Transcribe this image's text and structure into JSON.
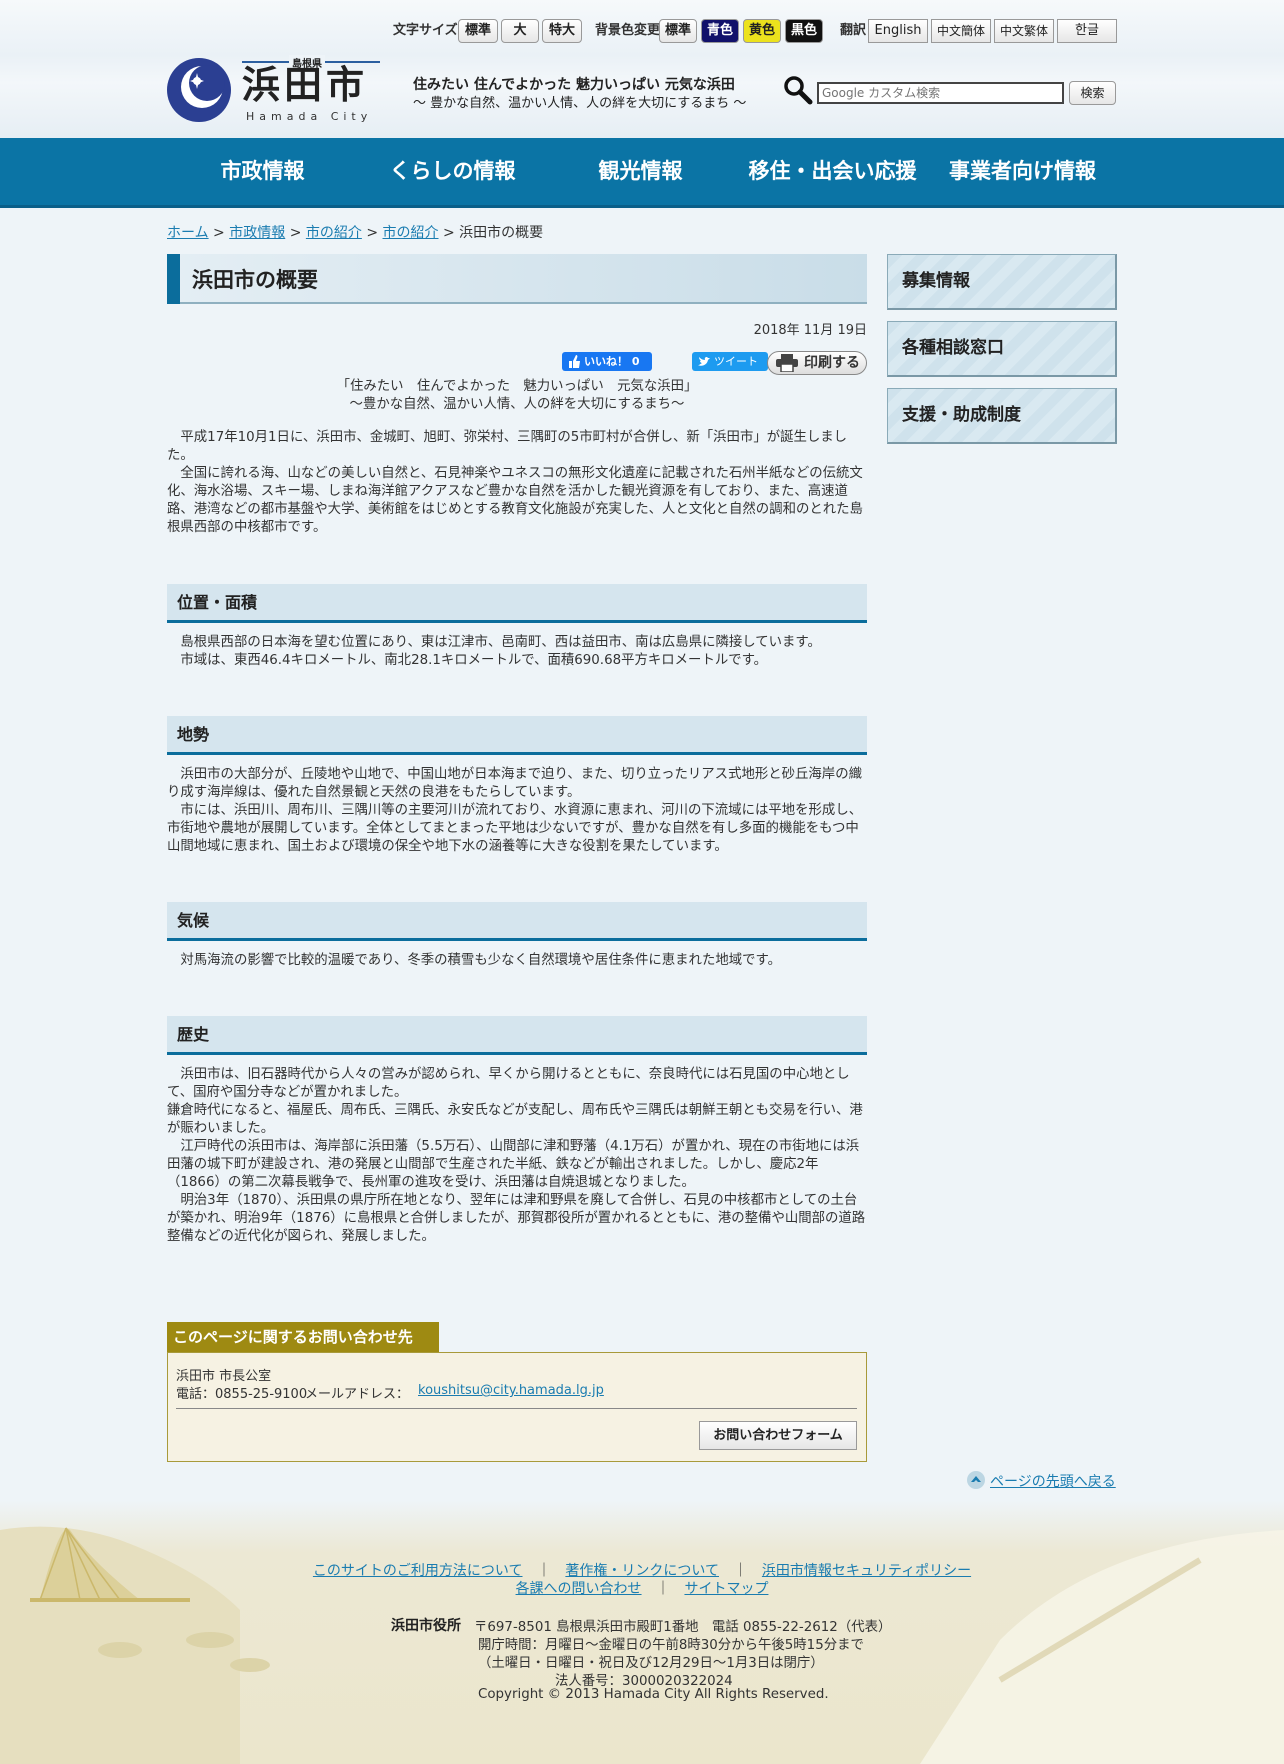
{
  "header": {
    "font_size_label": "文字サイズ",
    "font_std": "標準",
    "font_large": "大",
    "font_xlarge": "特大",
    "bg_label": "背景色変更",
    "bg_std": "標準",
    "bg_blue": "青色",
    "bg_yellow": "黄色",
    "bg_black": "黒色",
    "translate_label": "翻訳",
    "lang_en": "English",
    "lang_zh_cn": "中文簡体",
    "lang_zh_tw": "中文繁体",
    "lang_ko": "한글",
    "logo_pref": "島根県",
    "logo_city": "浜田市",
    "logo_roman": "Hamada City",
    "tagline1": "住みたい 住んでよかった 魅力いっぱい 元気な浜田",
    "tagline2": "〜 豊かな自然、温かい人情、人の絆を大切にするまち 〜",
    "search_placeholder": "Google カスタム検索",
    "search_button": "検索"
  },
  "nav": [
    "市政情報",
    "くらしの情報",
    "観光情報",
    "移住・出会い応援",
    "事業者向け情報"
  ],
  "breadcrumb": {
    "home": "ホーム",
    "l1": "市政情報",
    "l2": "市の紹介",
    "l3": "市の紹介",
    "sep": ">",
    "current": "浜田市の概要"
  },
  "page": {
    "title": "浜田市の概要",
    "date": "2018年 11月 19日",
    "like": "いいね！ 0",
    "tweet": "ツイート",
    "print": "印刷する",
    "motto1": "「住みたい　住んでよかった　魅力いっぱい　元気な浜田」",
    "motto2": "～豊かな自然、温かい人情、人の絆を大切にするまち～",
    "intro": "　平成17年10月1日に、浜田市、金城町、旭町、弥栄村、三隅町の5市町村が合併し、新「浜田市」が誕生しました。\n　全国に誇れる海、山などの美しい自然と、石見神楽やユネスコの無形文化遺産に記載された石州半紙などの伝統文化、海水浴場、スキー場、しまね海洋館アクアスなど豊かな自然を活かした観光資源を有しており、また、高速道路、港湾などの都市基盤や大学、美術館をはじめとする教育文化施設が充実した、人と文化と自然の調和のとれた島根県西部の中核都市です。",
    "sections": [
      {
        "heading": "位置・面積",
        "body": "　島根県西部の日本海を望む位置にあり、東は江津市、邑南町、西は益田市、南は広島県に隣接しています。\n　市域は、東西46.4キロメートル、南北28.1キロメートルで、面積690.68平方キロメートルです。"
      },
      {
        "heading": "地勢",
        "body": "　浜田市の大部分が、丘陵地や山地で、中国山地が日本海まで迫り、また、切り立ったリアス式地形と砂丘海岸の織り成す海岸線は、優れた自然景観と天然の良港をもたらしています。\n　市には、浜田川、周布川、三隅川等の主要河川が流れており、水資源に恵まれ、河川の下流域には平地を形成し、市街地や農地が展開しています。全体としてまとまった平地は少ないですが、豊かな自然を有し多面的機能をもつ中山間地域に恵まれ、国土および環境の保全や地下水の涵養等に大きな役割を果たしています。"
      },
      {
        "heading": "気候",
        "body": "　対馬海流の影響で比較的温暖であり、冬季の積雪も少なく自然環境や居住条件に恵まれた地域です。"
      },
      {
        "heading": "歴史",
        "body": "　浜田市は、旧石器時代から人々の営みが認められ、早くから開けるとともに、奈良時代には石見国の中心地として、国府や国分寺などが置かれました。\n鎌倉時代になると、福屋氏、周布氏、三隅氏、永安氏などが支配し、周布氏や三隅氏は朝鮮王朝とも交易を行い、港が賑わいました。\n　江戸時代の浜田市は、海岸部に浜田藩（5.5万石）、山間部に津和野藩（4.1万石）が置かれ、現在の市街地には浜田藩の城下町が建設され、港の発展と山間部で生産された半紙、鉄などが輸出されました。しかし、慶応2年（1866）の第二次幕長戦争で、長州軍の進攻を受け、浜田藩は自焼退城となりました。\n　明治3年（1870）、浜田県の県庁所在地となり、翌年には津和野県を廃して合併し、石見の中核都市としての土台が築かれ、明治9年（1876）に島根県と合併しましたが、那賀郡役所が置かれるとともに、港の整備や山間部の道路整備などの近代化が図られ、発展しました。"
      }
    ],
    "contact_title": "このページに関するお問い合わせ先",
    "contact_dept": "浜田市 市長公室",
    "contact_tel": "電話：0855-25-9100",
    "contact_mail_label": "メールアドレス：",
    "contact_mail": "koushitsu@city.hamada.lg.jp",
    "contact_form": "お問い合わせフォーム",
    "back_to_top": "ページの先頭へ戻る"
  },
  "sidebar": [
    "募集情報",
    "各種相談窓口",
    "支援・助成制度"
  ],
  "footer": {
    "link1": "このサイトのご利用方法について",
    "link2": "著作権・リンクについて",
    "link3": "浜田市情報セキュリティポリシー",
    "link4": "各課への問い合わせ",
    "link5": "サイトマップ",
    "sep": "｜",
    "office": "浜田市役所",
    "address": "〒697-8501 島根県浜田市殿町1番地　電話 0855-22-2612（代表）",
    "hours1": "開庁時間：月曜日～金曜日の午前8時30分から午後5時15分まで",
    "hours2": "（土曜日・日曜日・祝日及び12月29日～1月3日は閉庁）",
    "corp_no": "法人番号：3000020322024",
    "copyright": "Copyright © 2013 Hamada City All Rights Reserved."
  }
}
